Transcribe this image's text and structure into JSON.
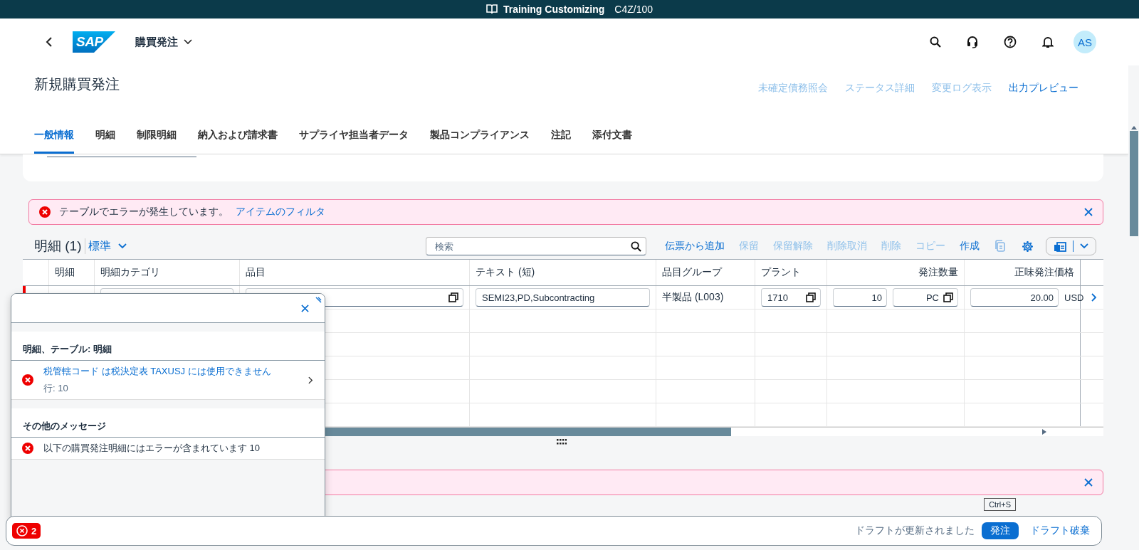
{
  "shell_bar": {
    "title": "Training Customizing",
    "system": "C4Z/100"
  },
  "header": {
    "logo": "SAP",
    "app_title": "購買発注",
    "avatar": "AS"
  },
  "page": {
    "title": "新規購買発注",
    "actions": [
      {
        "label": "未確定債務照会",
        "enabled": false
      },
      {
        "label": "ステータス詳細",
        "enabled": false
      },
      {
        "label": "変更ログ表示",
        "enabled": false
      },
      {
        "label": "出力プレビュー",
        "enabled": true
      }
    ]
  },
  "tabs": [
    {
      "label": "一般情報",
      "selected": true
    },
    {
      "label": "明細",
      "selected": false
    },
    {
      "label": "制限明細",
      "selected": false
    },
    {
      "label": "納入および請求書",
      "selected": false
    },
    {
      "label": "サプライヤ担当者データ",
      "selected": false
    },
    {
      "label": "製品コンプライアンス",
      "selected": false
    },
    {
      "label": "注記",
      "selected": false
    },
    {
      "label": "添付文書",
      "selected": false
    }
  ],
  "message_strips": [
    {
      "kind": "error",
      "text": "テーブルでエラーが発生しています。",
      "link": "アイテムのフィルタ"
    },
    {
      "kind": "error"
    }
  ],
  "items_table": {
    "title": "明細 (1)",
    "variant": "標準",
    "search_placeholder": "検索",
    "actions": [
      {
        "label": "伝票から追加",
        "enabled": true
      },
      {
        "label": "保留",
        "enabled": false
      },
      {
        "label": "保留解除",
        "enabled": false
      },
      {
        "label": "削除取消",
        "enabled": false
      },
      {
        "label": "削除",
        "enabled": false
      },
      {
        "label": "コピー",
        "enabled": false
      },
      {
        "label": "作成",
        "enabled": true
      }
    ],
    "columns": [
      "明細",
      "明細カテゴリ",
      "品目",
      "テキスト (短)",
      "品目グループ",
      "プラント",
      "発注数量",
      "正味発注価格"
    ],
    "rows": [
      {
        "error": true,
        "text": "SEMI23,PD,Subcontracting",
        "material_group": "半製品 (L003)",
        "plant": "1710",
        "quantity": "10",
        "unit": "PC",
        "net_price": "20.00",
        "currency": "USD"
      }
    ]
  },
  "message_popover": {
    "groups": [
      {
        "title": "明細、テーブル: 明細",
        "messages": [
          {
            "kind": "error",
            "title": "税管轄コード は税決定表 TAXUSJ には使用できません",
            "subtitle": "行: 10",
            "navigable": true
          }
        ]
      },
      {
        "title": "その他のメッセージ",
        "messages": [
          {
            "kind": "error",
            "title": "以下の購買発注明細にはエラーが含まれています 10",
            "navigable": false
          }
        ]
      }
    ]
  },
  "footer": {
    "error_count": "2",
    "status": "ドラフトが更新されました",
    "primary": "発注",
    "secondary": "ドラフト破棄",
    "tooltip": "Ctrl+S"
  }
}
